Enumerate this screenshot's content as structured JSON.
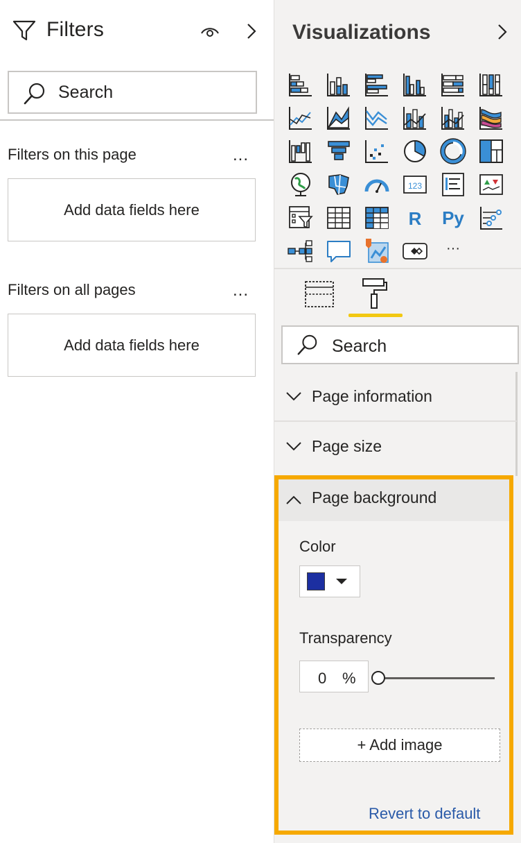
{
  "filters": {
    "title": "Filters",
    "search_placeholder": "Search",
    "sections": [
      {
        "label": "Filters on this page",
        "more": "...",
        "drop_text": "Add data fields here"
      },
      {
        "label": "Filters on all pages",
        "more": "...",
        "drop_text": "Add data fields here"
      }
    ],
    "icons": {
      "funnel": "funnel-icon",
      "eye": "eye-icon",
      "collapse": "chevron-right-icon"
    }
  },
  "visualizations": {
    "title": "Visualizations",
    "icons": [
      "stacked-bar-chart-icon",
      "stacked-column-chart-icon",
      "clustered-bar-chart-icon",
      "clustered-column-chart-icon",
      "100-stacked-bar-chart-icon",
      "100-stacked-column-chart-icon",
      "line-chart-icon",
      "area-chart-icon",
      "stacked-area-chart-icon",
      "line-and-stacked-column-chart-icon",
      "line-and-clustered-column-chart-icon",
      "ribbon-chart-icon",
      "waterfall-chart-icon",
      "funnel-chart-icon",
      "scatter-chart-icon",
      "pie-chart-icon",
      "donut-chart-icon",
      "treemap-icon",
      "map-icon",
      "filled-map-icon",
      "gauge-icon",
      "card-icon",
      "multi-row-card-icon",
      "kpi-icon",
      "slicer-icon",
      "table-icon",
      "matrix-icon",
      "r-script-visual-icon",
      "python-visual-icon",
      "key-influencers-icon",
      "decomposition-tree-icon",
      "qa-icon",
      "arcgis-map-icon",
      "power-apps-icon",
      "more-visuals-icon"
    ],
    "glyph_text": {
      "card": "123",
      "r": "R",
      "py": "Py",
      "more": "···"
    },
    "tabs": {
      "fields": "fields-tab-icon",
      "format": "format-paint-roller-icon"
    },
    "search_placeholder": "Search",
    "format_sections": [
      {
        "label": "Page information",
        "expanded": false
      },
      {
        "label": "Page size",
        "expanded": false
      },
      {
        "label": "Page background",
        "expanded": true
      }
    ],
    "page_background": {
      "color_label": "Color",
      "color_value": "#1c2fa1",
      "transparency_label": "Transparency",
      "transparency_value": "0",
      "transparency_unit": "%",
      "add_image_label": "+ Add image",
      "revert_label": "Revert to default"
    }
  },
  "colors": {
    "highlight": "#f6a900",
    "tab_underline": "#f2c811",
    "link": "#2a5aa8",
    "icon_blue": "#3a8fd6"
  }
}
